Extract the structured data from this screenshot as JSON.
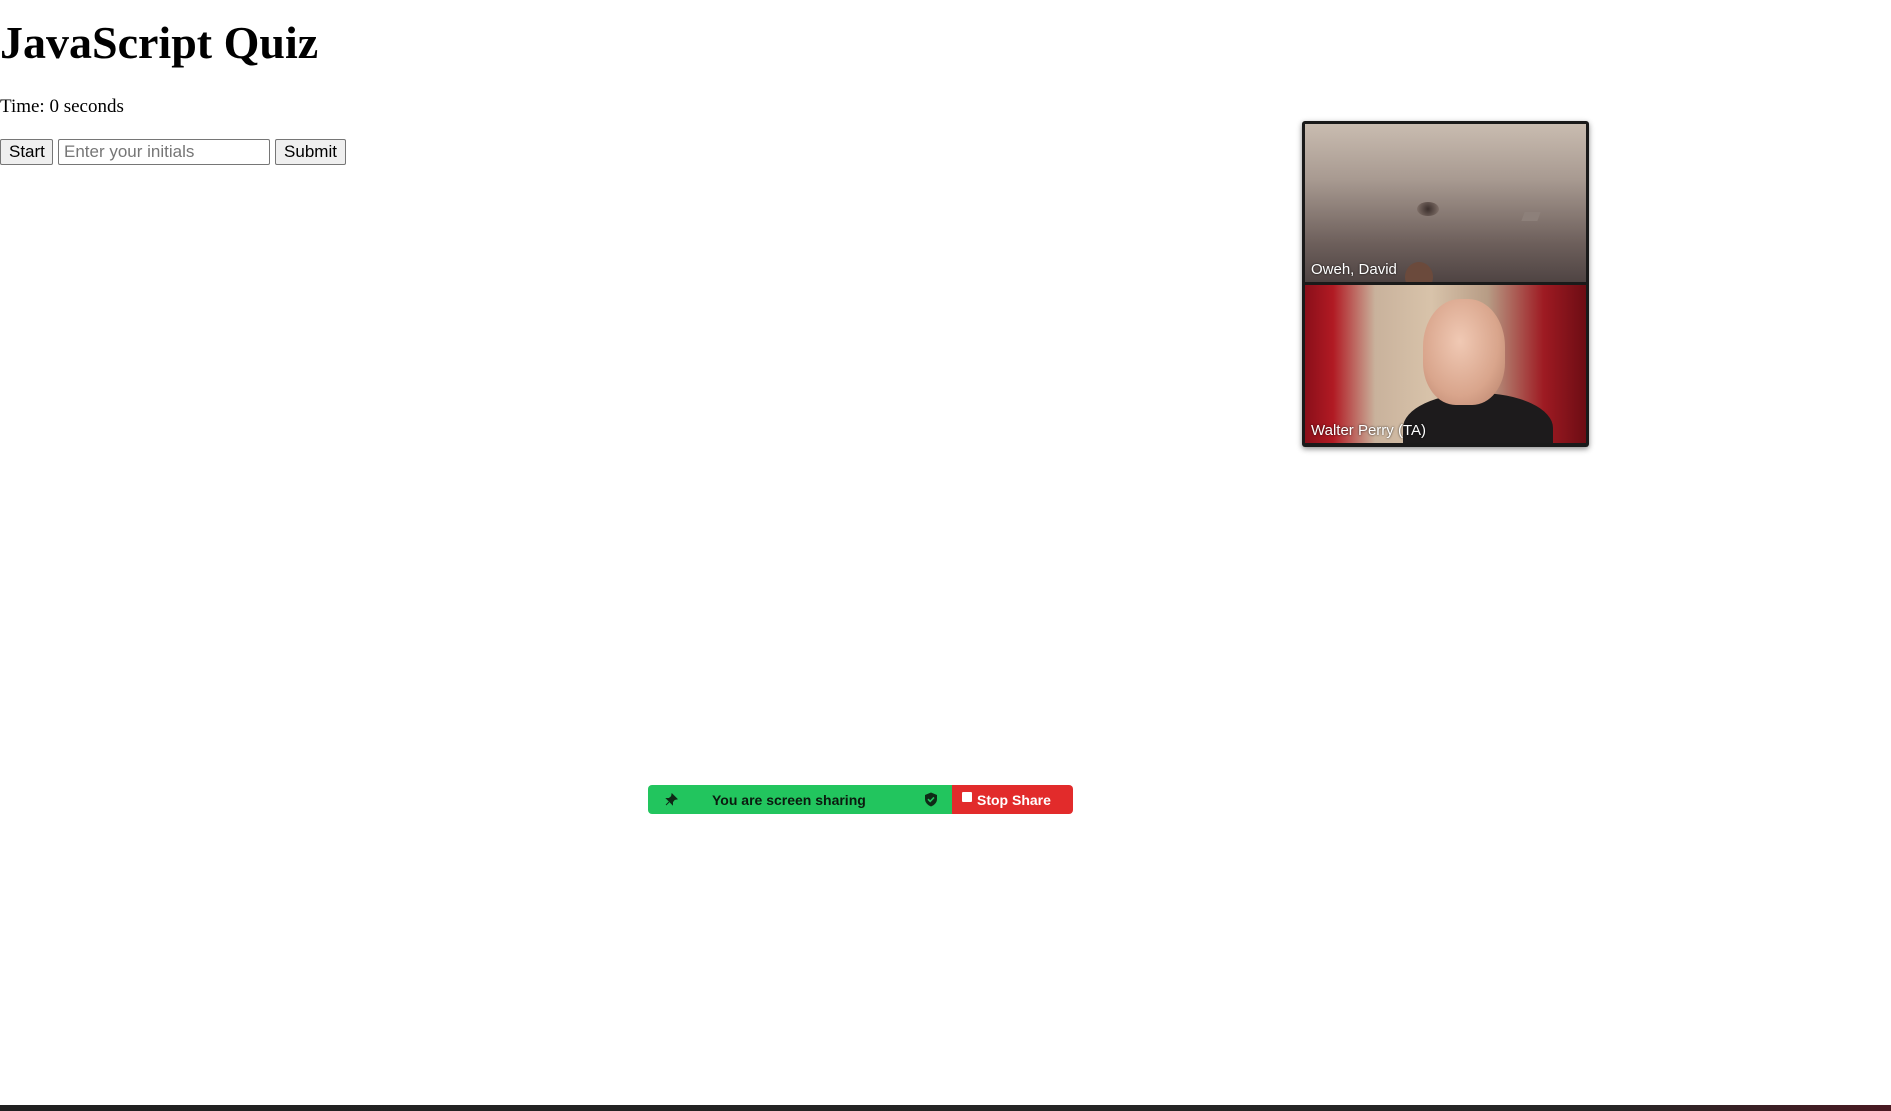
{
  "page": {
    "title": "JavaScript Quiz",
    "timer_text": "Time: 0 seconds"
  },
  "controls": {
    "start_label": "Start",
    "initials_placeholder": "Enter your initials",
    "initials_value": "",
    "submit_label": "Submit"
  },
  "video_panel": {
    "participants": [
      {
        "name": "Oweh, David"
      },
      {
        "name": "Walter Perry (TA)"
      }
    ]
  },
  "share_bar": {
    "status_text": "You are screen sharing",
    "stop_label": "Stop Share",
    "pin_icon": "pin-icon",
    "shield_icon": "shield-icon",
    "stop_icon": "stop-icon",
    "colors": {
      "green": "#22c55e",
      "red": "#e22b2b"
    }
  }
}
